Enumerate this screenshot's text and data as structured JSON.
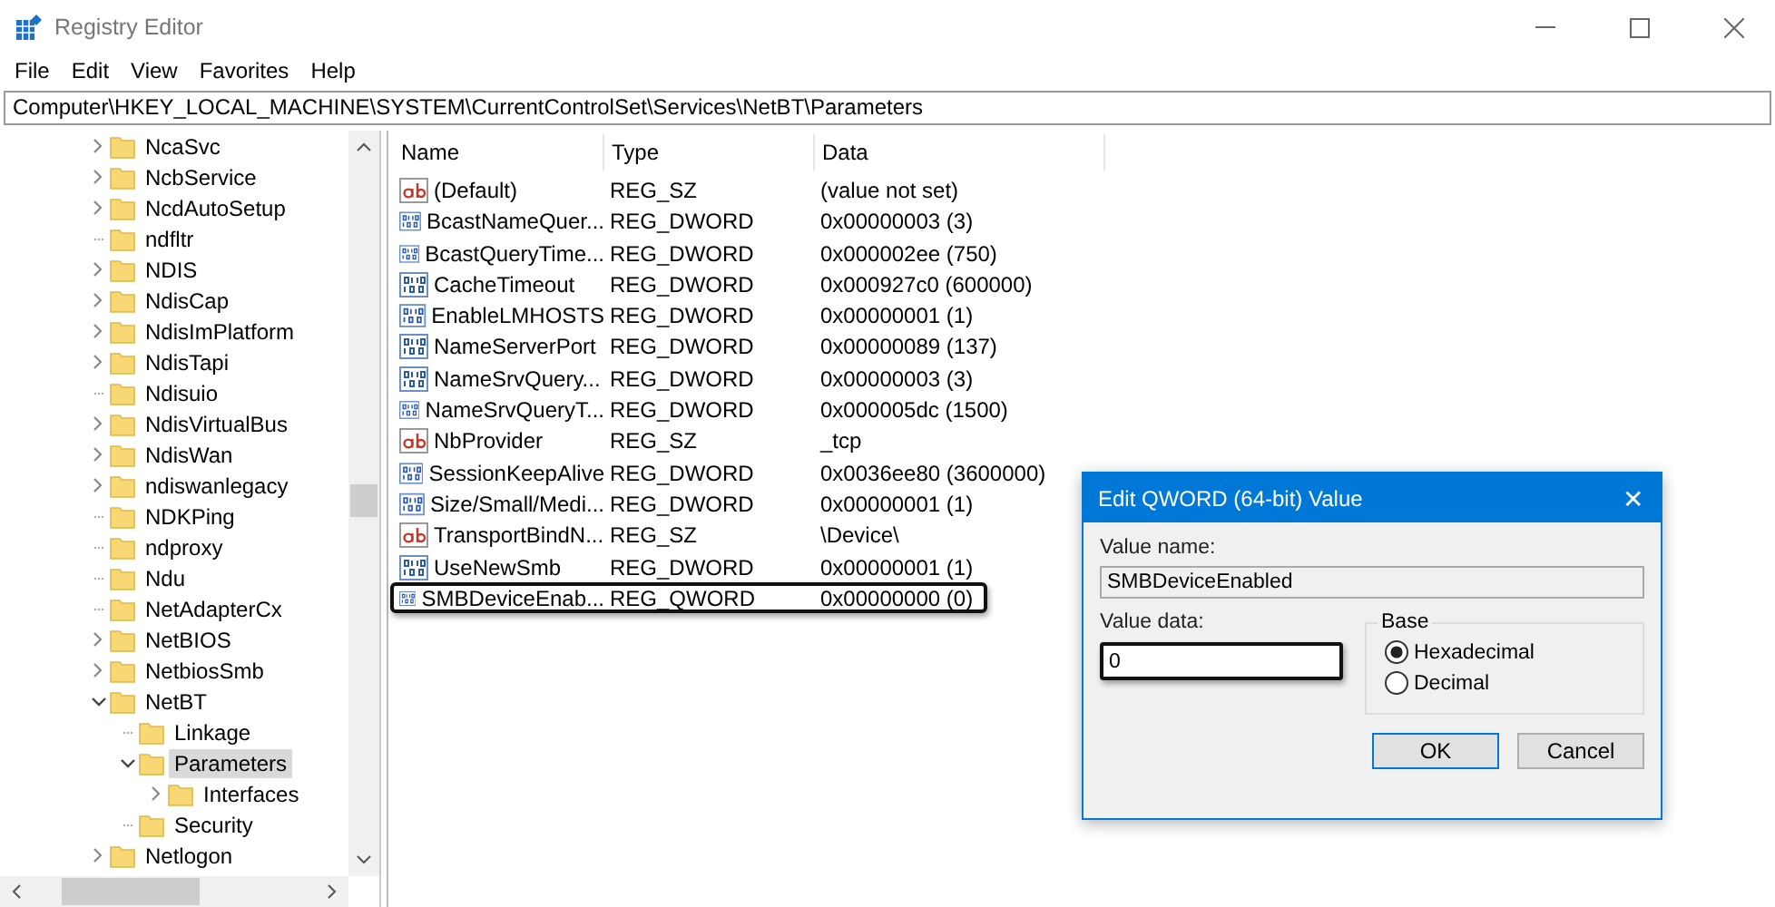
{
  "window": {
    "title": "Registry Editor"
  },
  "menu": [
    "File",
    "Edit",
    "View",
    "Favorites",
    "Help"
  ],
  "address": "Computer\\HKEY_LOCAL_MACHINE\\SYSTEM\\CurrentControlSet\\Services\\NetBT\\Parameters",
  "tree": [
    {
      "label": "NcaSvc",
      "expandable": true,
      "expanded": false,
      "selected": false
    },
    {
      "label": "NcbService",
      "expandable": true,
      "expanded": false,
      "selected": false
    },
    {
      "label": "NcdAutoSetup",
      "expandable": true,
      "expanded": false,
      "selected": false
    },
    {
      "label": "ndfltr",
      "expandable": false,
      "selected": false
    },
    {
      "label": "NDIS",
      "expandable": true,
      "expanded": false,
      "selected": false
    },
    {
      "label": "NdisCap",
      "expandable": true,
      "expanded": false,
      "selected": false
    },
    {
      "label": "NdisImPlatform",
      "expandable": true,
      "expanded": false,
      "selected": false
    },
    {
      "label": "NdisTapi",
      "expandable": true,
      "expanded": false,
      "selected": false
    },
    {
      "label": "Ndisuio",
      "expandable": false,
      "selected": false
    },
    {
      "label": "NdisVirtualBus",
      "expandable": true,
      "expanded": false,
      "selected": false
    },
    {
      "label": "NdisWan",
      "expandable": true,
      "expanded": false,
      "selected": false
    },
    {
      "label": "ndiswanlegacy",
      "expandable": true,
      "expanded": false,
      "selected": false
    },
    {
      "label": "NDKPing",
      "expandable": false,
      "selected": false
    },
    {
      "label": "ndproxy",
      "expandable": false,
      "selected": false
    },
    {
      "label": "Ndu",
      "expandable": false,
      "selected": false
    },
    {
      "label": "NetAdapterCx",
      "expandable": false,
      "selected": false
    },
    {
      "label": "NetBIOS",
      "expandable": true,
      "expanded": false,
      "selected": false
    },
    {
      "label": "NetbiosSmb",
      "expandable": true,
      "expanded": false,
      "selected": false
    },
    {
      "label": "NetBT",
      "expandable": true,
      "expanded": true,
      "selected": false,
      "children": [
        {
          "label": "Linkage",
          "expandable": false,
          "selected": false
        },
        {
          "label": "Parameters",
          "expandable": true,
          "expanded": true,
          "selected": true,
          "children": [
            {
              "label": "Interfaces",
              "expandable": true,
              "expanded": false,
              "selected": false
            }
          ]
        },
        {
          "label": "Security",
          "expandable": false,
          "selected": false
        }
      ]
    },
    {
      "label": "Netlogon",
      "expandable": true,
      "expanded": false,
      "selected": false
    }
  ],
  "list": {
    "columns": [
      "Name",
      "Type",
      "Data"
    ],
    "rows": [
      {
        "kind": "string",
        "name": "(Default)",
        "type": "REG_SZ",
        "data": "(value not set)",
        "selected": false
      },
      {
        "kind": "binary",
        "name": "BcastNameQuer...",
        "type": "REG_DWORD",
        "data": "0x00000003 (3)",
        "selected": false
      },
      {
        "kind": "binary",
        "name": "BcastQueryTime...",
        "type": "REG_DWORD",
        "data": "0x000002ee (750)",
        "selected": false
      },
      {
        "kind": "binary",
        "name": "CacheTimeout",
        "type": "REG_DWORD",
        "data": "0x000927c0 (600000)",
        "selected": false
      },
      {
        "kind": "binary",
        "name": "EnableLMHOSTS",
        "type": "REG_DWORD",
        "data": "0x00000001 (1)",
        "selected": false
      },
      {
        "kind": "binary",
        "name": "NameServerPort",
        "type": "REG_DWORD",
        "data": "0x00000089 (137)",
        "selected": false
      },
      {
        "kind": "binary",
        "name": "NameSrvQuery...",
        "type": "REG_DWORD",
        "data": "0x00000003 (3)",
        "selected": false
      },
      {
        "kind": "binary",
        "name": "NameSrvQueryT...",
        "type": "REG_DWORD",
        "data": "0x000005dc (1500)",
        "selected": false
      },
      {
        "kind": "string",
        "name": "NbProvider",
        "type": "REG_SZ",
        "data": "_tcp",
        "selected": false
      },
      {
        "kind": "binary",
        "name": "SessionKeepAlive",
        "type": "REG_DWORD",
        "data": "0x0036ee80 (3600000)",
        "selected": false
      },
      {
        "kind": "binary",
        "name": "Size/Small/Medi...",
        "type": "REG_DWORD",
        "data": "0x00000001 (1)",
        "selected": false
      },
      {
        "kind": "string",
        "name": "TransportBindN...",
        "type": "REG_SZ",
        "data": "\\Device\\",
        "selected": false
      },
      {
        "kind": "binary",
        "name": "UseNewSmb",
        "type": "REG_DWORD",
        "data": "0x00000001 (1)",
        "selected": false
      },
      {
        "kind": "binary",
        "name": "SMBDeviceEnab...",
        "type": "REG_QWORD",
        "data": "0x00000000 (0)",
        "selected": true
      }
    ]
  },
  "dialog": {
    "title": "Edit QWORD (64-bit) Value",
    "close": "✕",
    "name_label": "Value name:",
    "name_value": "SMBDeviceEnabled",
    "data_label": "Value data:",
    "data_value": "0",
    "base_label": "Base",
    "bases": [
      {
        "label": "Hexadecimal",
        "selected": true
      },
      {
        "label": "Decimal",
        "selected": false
      }
    ],
    "buttons": [
      "OK",
      "Cancel"
    ]
  }
}
